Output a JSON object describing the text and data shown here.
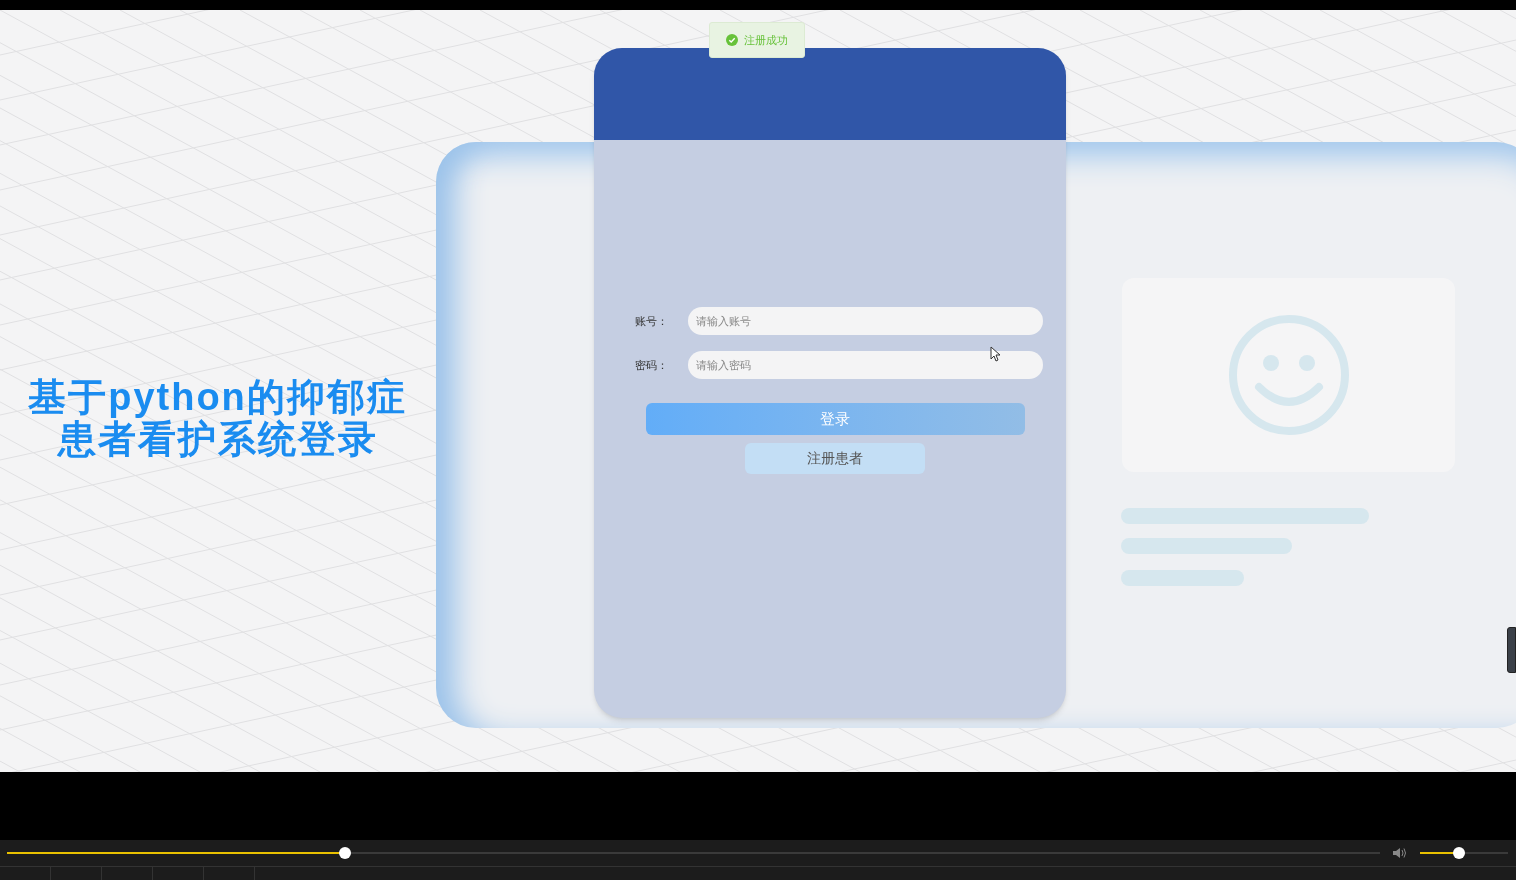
{
  "toast": {
    "text": "注册成功"
  },
  "title_lines": [
    "基于python的抑郁症",
    "患者看护系统登录"
  ],
  "form": {
    "fields": [
      {
        "label": "账号：",
        "placeholder": "请输入账号"
      },
      {
        "label": "密码：",
        "placeholder": "请输入密码"
      }
    ],
    "buttons": [
      {
        "label": "登录",
        "kind": "primary"
      },
      {
        "label": "注册患者",
        "kind": "secondary"
      }
    ]
  },
  "player": {
    "progress": {
      "level": 0.246
    },
    "volume": {
      "level": 0.44
    }
  }
}
